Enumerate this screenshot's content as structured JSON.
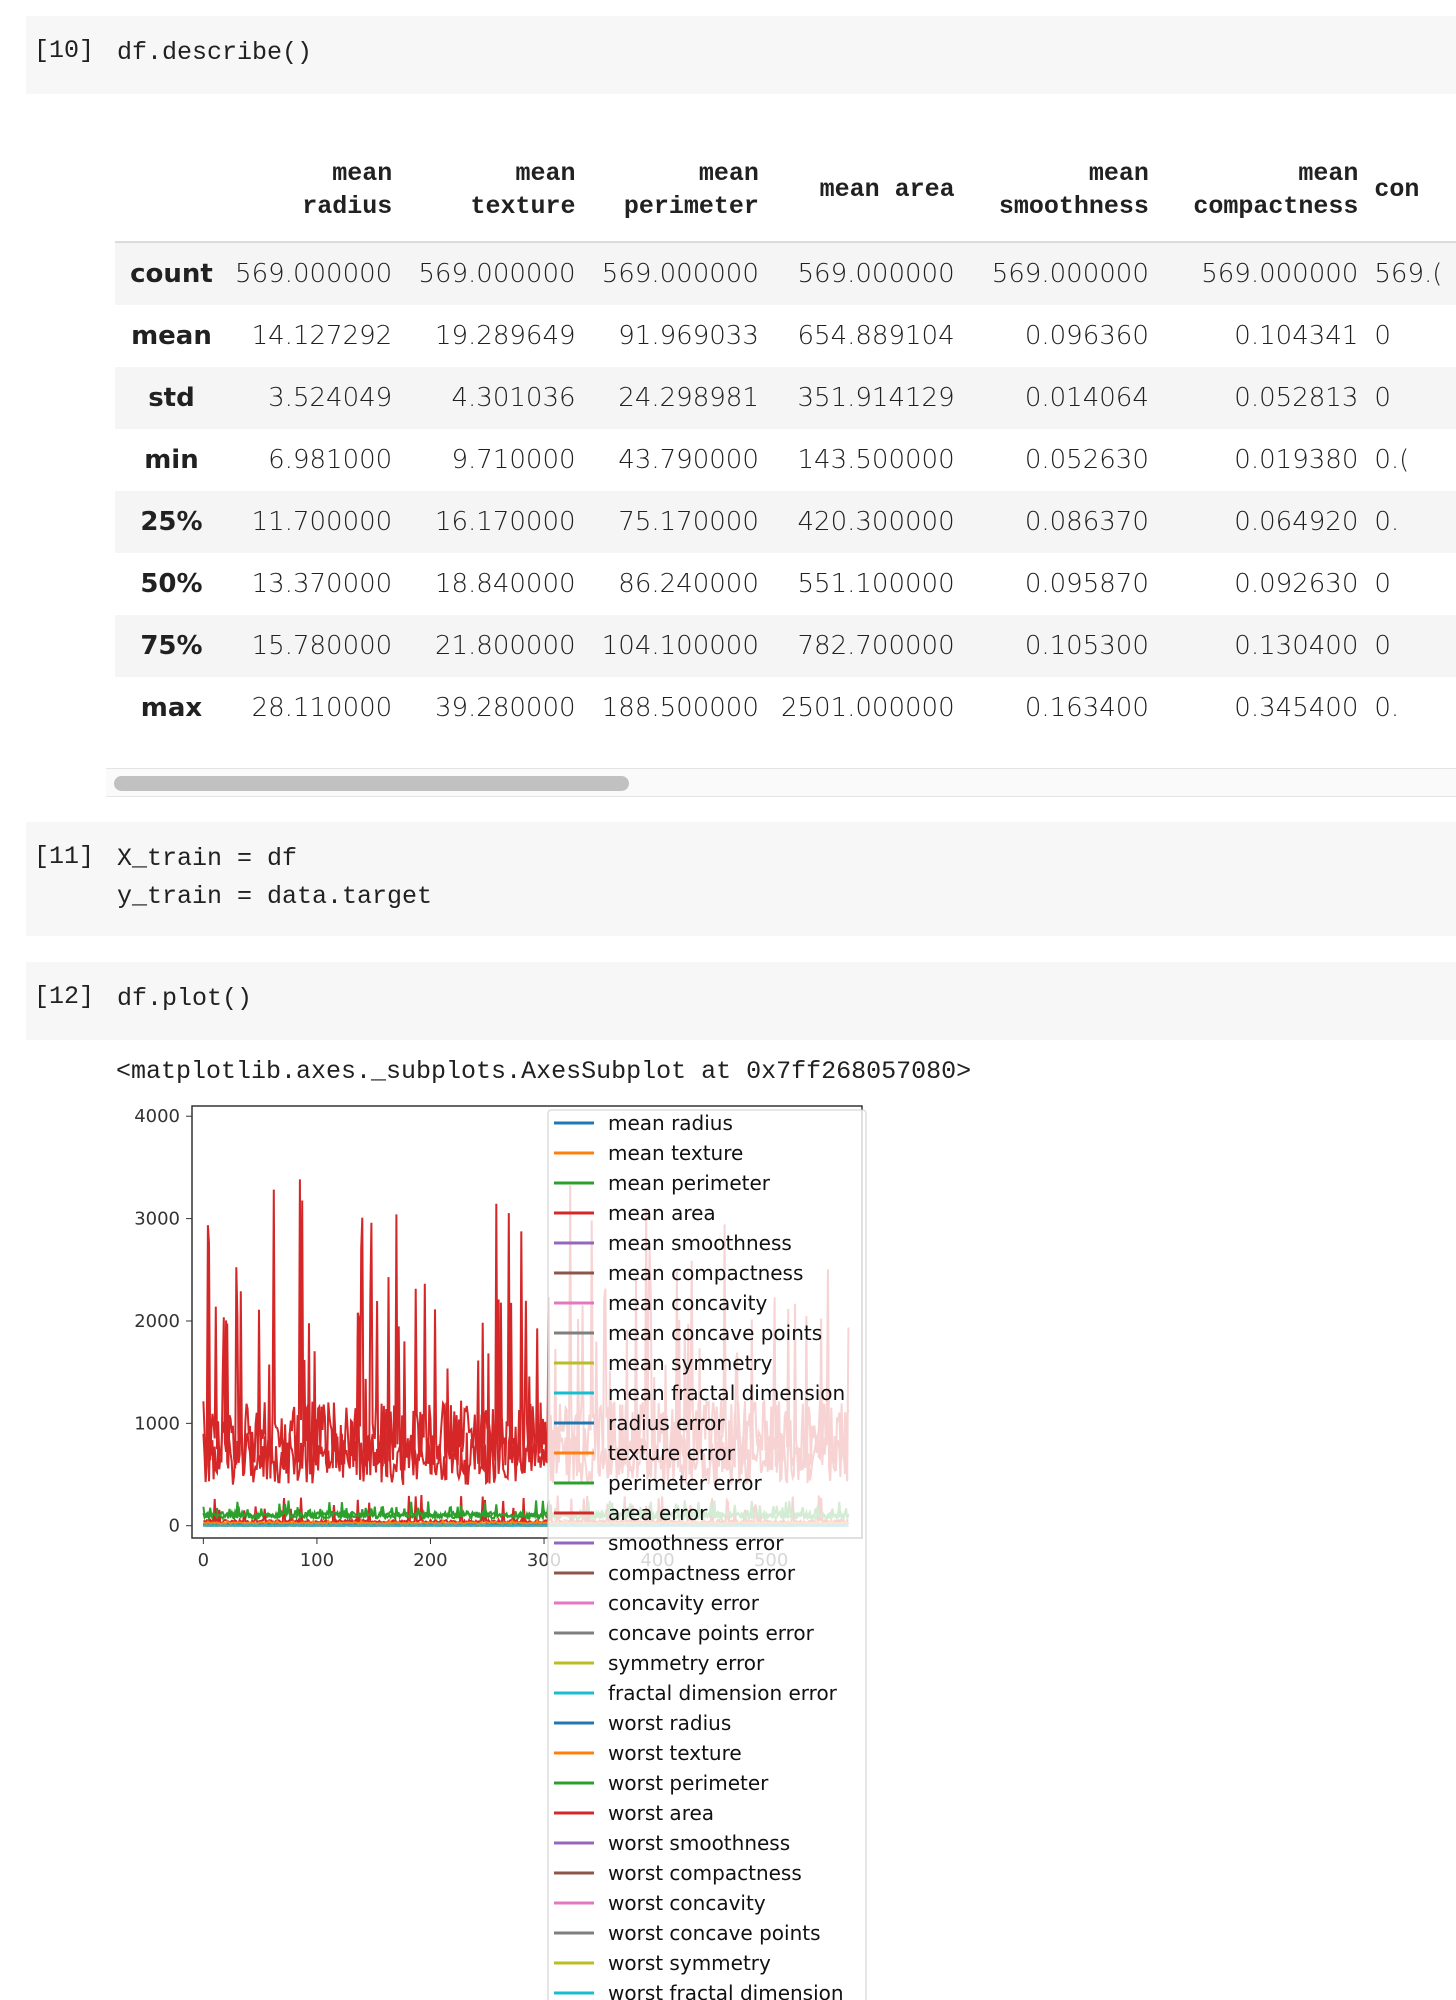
{
  "cells": [
    {
      "prompt": "[10]",
      "code": "df.describe()"
    },
    {
      "prompt": "[11]",
      "code": "X_train = df\ny_train = data.target"
    },
    {
      "prompt": "[12]",
      "code": "df.plot()"
    }
  ],
  "describe": {
    "columns": [
      {
        "line1": "mean",
        "line2": "radius"
      },
      {
        "line1": "mean",
        "line2": "texture"
      },
      {
        "line1": "mean",
        "line2": "perimeter"
      },
      {
        "line1": "",
        "line2": "mean area"
      },
      {
        "line1": "mean",
        "line2": "smoothness"
      },
      {
        "line1": "mean",
        "line2": "compactness"
      },
      {
        "line1": "",
        "line2": "con"
      }
    ],
    "rows": [
      {
        "label": "count",
        "values": [
          "569.000000",
          "569.000000",
          "569.000000",
          "569.000000",
          "569.000000",
          "569.000000",
          "569.("
        ]
      },
      {
        "label": "mean",
        "values": [
          "14.127292",
          "19.289649",
          "91.969033",
          "654.889104",
          "0.096360",
          "0.104341",
          "0"
        ]
      },
      {
        "label": "std",
        "values": [
          "3.524049",
          "4.301036",
          "24.298981",
          "351.914129",
          "0.014064",
          "0.052813",
          "0"
        ]
      },
      {
        "label": "min",
        "values": [
          "6.981000",
          "9.710000",
          "43.790000",
          "143.500000",
          "0.052630",
          "0.019380",
          "0.("
        ]
      },
      {
        "label": "25%",
        "values": [
          "11.700000",
          "16.170000",
          "75.170000",
          "420.300000",
          "0.086370",
          "0.064920",
          "0."
        ]
      },
      {
        "label": "50%",
        "values": [
          "13.370000",
          "18.840000",
          "86.240000",
          "551.100000",
          "0.095870",
          "0.092630",
          "0"
        ]
      },
      {
        "label": "75%",
        "values": [
          "15.780000",
          "21.800000",
          "104.100000",
          "782.700000",
          "0.105300",
          "0.130400",
          "0"
        ]
      },
      {
        "label": "max",
        "values": [
          "28.110000",
          "39.280000",
          "188.500000",
          "2501.000000",
          "0.163400",
          "0.345400",
          "0."
        ]
      }
    ]
  },
  "plot_output_text": "<matplotlib.axes._subplots.AxesSubplot at 0x7ff268057080>",
  "chart_data": {
    "type": "line",
    "title": "",
    "xlabel": "",
    "ylabel": "",
    "xlim": [
      -10,
      580
    ],
    "ylim": [
      -120,
      4100
    ],
    "xticks": [
      0,
      100,
      200,
      300,
      400,
      500
    ],
    "yticks": [
      0,
      1000,
      2000,
      3000,
      4000
    ],
    "tick_labels_x": [
      "0",
      "100",
      "200",
      "300",
      "400",
      "500"
    ],
    "tick_labels_y": [
      "0",
      "1000",
      "2000",
      "3000",
      "4000"
    ],
    "grid": false,
    "legend_position": "upper-right, overflowing below axes",
    "n_points": 569,
    "series": [
      {
        "name": "mean radius",
        "color": "#1f77b4",
        "min": 6.981,
        "mean": 14.127292,
        "max": 28.11
      },
      {
        "name": "mean texture",
        "color": "#ff7f0e",
        "min": 9.71,
        "mean": 19.289649,
        "max": 39.28
      },
      {
        "name": "mean perimeter",
        "color": "#2ca02c",
        "min": 43.79,
        "mean": 91.969033,
        "max": 188.5
      },
      {
        "name": "mean area",
        "color": "#d62728",
        "min": 143.5,
        "mean": 654.889104,
        "max": 2501.0
      },
      {
        "name": "mean smoothness",
        "color": "#9467bd"
      },
      {
        "name": "mean compactness",
        "color": "#8c564b"
      },
      {
        "name": "mean concavity",
        "color": "#e377c2"
      },
      {
        "name": "mean concave points",
        "color": "#7f7f7f"
      },
      {
        "name": "mean symmetry",
        "color": "#bcbd22"
      },
      {
        "name": "mean fractal dimension",
        "color": "#17becf"
      },
      {
        "name": "radius error",
        "color": "#1f77b4"
      },
      {
        "name": "texture error",
        "color": "#ff7f0e"
      },
      {
        "name": "perimeter error",
        "color": "#2ca02c"
      },
      {
        "name": "area error",
        "color": "#d62728"
      },
      {
        "name": "smoothness error",
        "color": "#9467bd"
      },
      {
        "name": "compactness error",
        "color": "#8c564b"
      },
      {
        "name": "concavity error",
        "color": "#e377c2"
      },
      {
        "name": "concave points error",
        "color": "#7f7f7f"
      },
      {
        "name": "symmetry error",
        "color": "#bcbd22"
      },
      {
        "name": "fractal dimension error",
        "color": "#17becf"
      },
      {
        "name": "worst radius",
        "color": "#1f77b4"
      },
      {
        "name": "worst texture",
        "color": "#ff7f0e"
      },
      {
        "name": "worst perimeter",
        "color": "#2ca02c"
      },
      {
        "name": "worst area",
        "color": "#d62728",
        "max": 4254.0
      },
      {
        "name": "worst smoothness",
        "color": "#9467bd"
      },
      {
        "name": "worst compactness",
        "color": "#8c564b"
      },
      {
        "name": "worst concavity",
        "color": "#e377c2"
      },
      {
        "name": "worst concave points",
        "color": "#7f7f7f"
      },
      {
        "name": "worst symmetry",
        "color": "#bcbd22"
      },
      {
        "name": "worst fractal dimension",
        "color": "#17becf"
      }
    ]
  }
}
